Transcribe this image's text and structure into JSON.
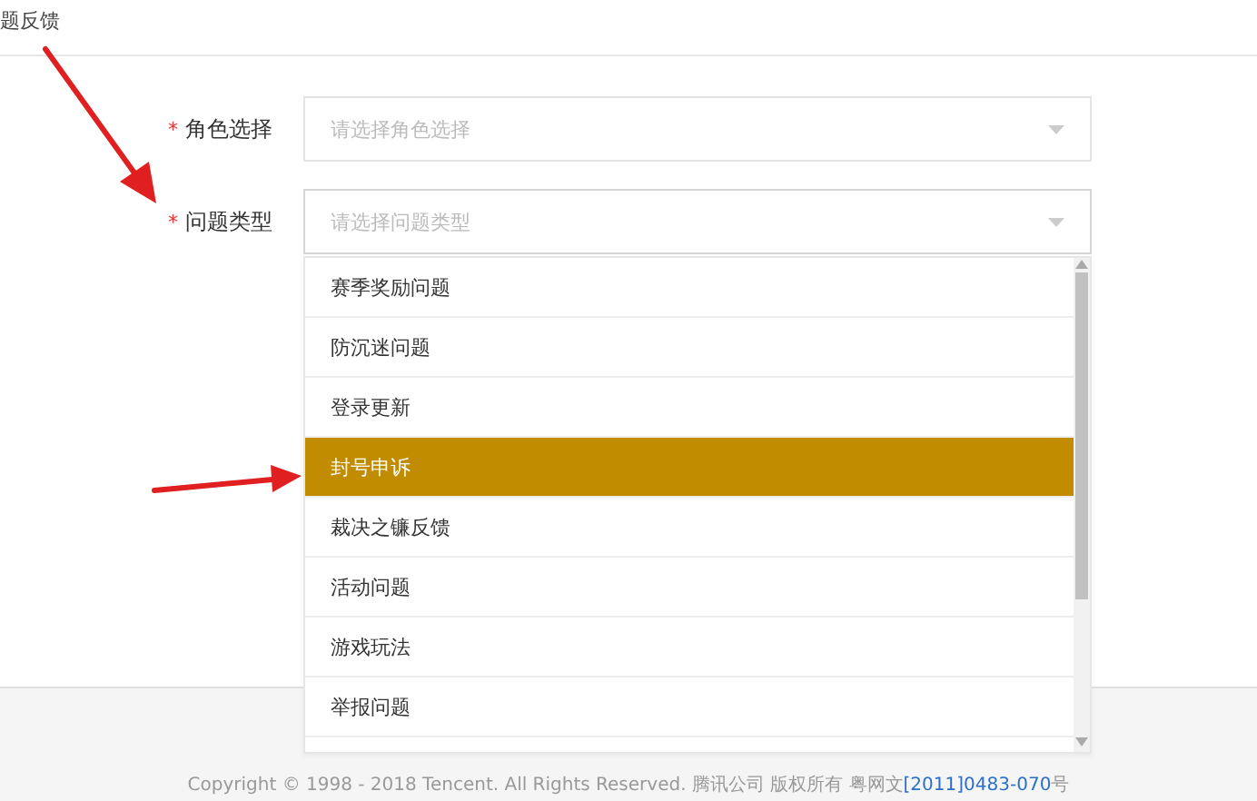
{
  "header": {
    "title": "题反馈"
  },
  "fields": [
    {
      "label": "角色选择",
      "required_mark": "*",
      "placeholder": "请选择角色选择"
    },
    {
      "label": "问题类型",
      "required_mark": "*",
      "placeholder": "请选择问题类型",
      "expanded": true,
      "options": [
        {
          "label": "赛季奖励问题",
          "selected": false
        },
        {
          "label": "防沉迷问题",
          "selected": false
        },
        {
          "label": "登录更新",
          "selected": false
        },
        {
          "label": "封号申诉",
          "selected": true
        },
        {
          "label": "裁决之镰反馈",
          "selected": false
        },
        {
          "label": "活动问题",
          "selected": false
        },
        {
          "label": "游戏玩法",
          "selected": false
        },
        {
          "label": "举报问题",
          "selected": false
        }
      ]
    }
  ],
  "footer": {
    "text": "Copyright © 1998 - 2018 Tencent. All Rights Reserved. 腾讯公司 版权所有 粤网文",
    "link": "[2011]0483-070",
    "suffix": "号"
  }
}
